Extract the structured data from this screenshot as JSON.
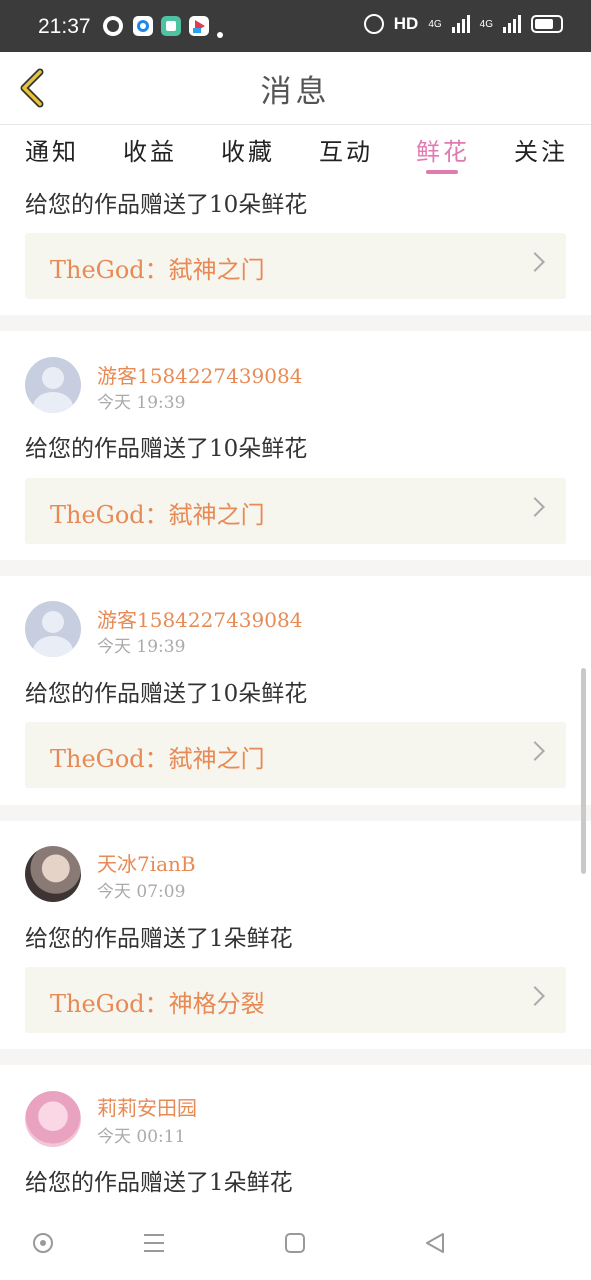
{
  "status_bar": {
    "time": "21:37",
    "hd": "HD",
    "network": "4G",
    "icons": [
      "compass-icon",
      "app-blue-icon",
      "app-teal-icon",
      "app-video-icon"
    ]
  },
  "header": {
    "title": "消息",
    "back_icon": "back-chevron-icon"
  },
  "tabs": [
    "通知",
    "收益",
    "收藏",
    "互动",
    "鲜花",
    "关注"
  ],
  "active_tab": "鲜花",
  "messages": [
    {
      "text": "给您的作品赠送了10朵鲜花",
      "card": "TheGod：弑神之门"
    },
    {
      "user": "游客1584227439084",
      "time": "今天 19:39",
      "text": "给您的作品赠送了10朵鲜花",
      "card": "TheGod：弑神之门"
    },
    {
      "user": "游客1584227439084",
      "time": "今天 19:39",
      "text": "给您的作品赠送了10朵鲜花",
      "card": "TheGod：弑神之门"
    },
    {
      "user": "天冰7ianB",
      "time": "今天 07:09",
      "text": "给您的作品赠送了1朵鲜花",
      "card": "TheGod：神格分裂"
    },
    {
      "user": "莉莉安田园",
      "time": "今天 00:11",
      "text": "给您的作品赠送了1朵鲜花"
    }
  ],
  "colors": {
    "accent": "#e07ab0",
    "username": "#e88a55",
    "card_bg": "#f6f5ee",
    "back": "#e8c43a"
  },
  "nav": [
    "home-circle-icon",
    "menu-icon",
    "square-icon",
    "back-triangle-icon"
  ]
}
